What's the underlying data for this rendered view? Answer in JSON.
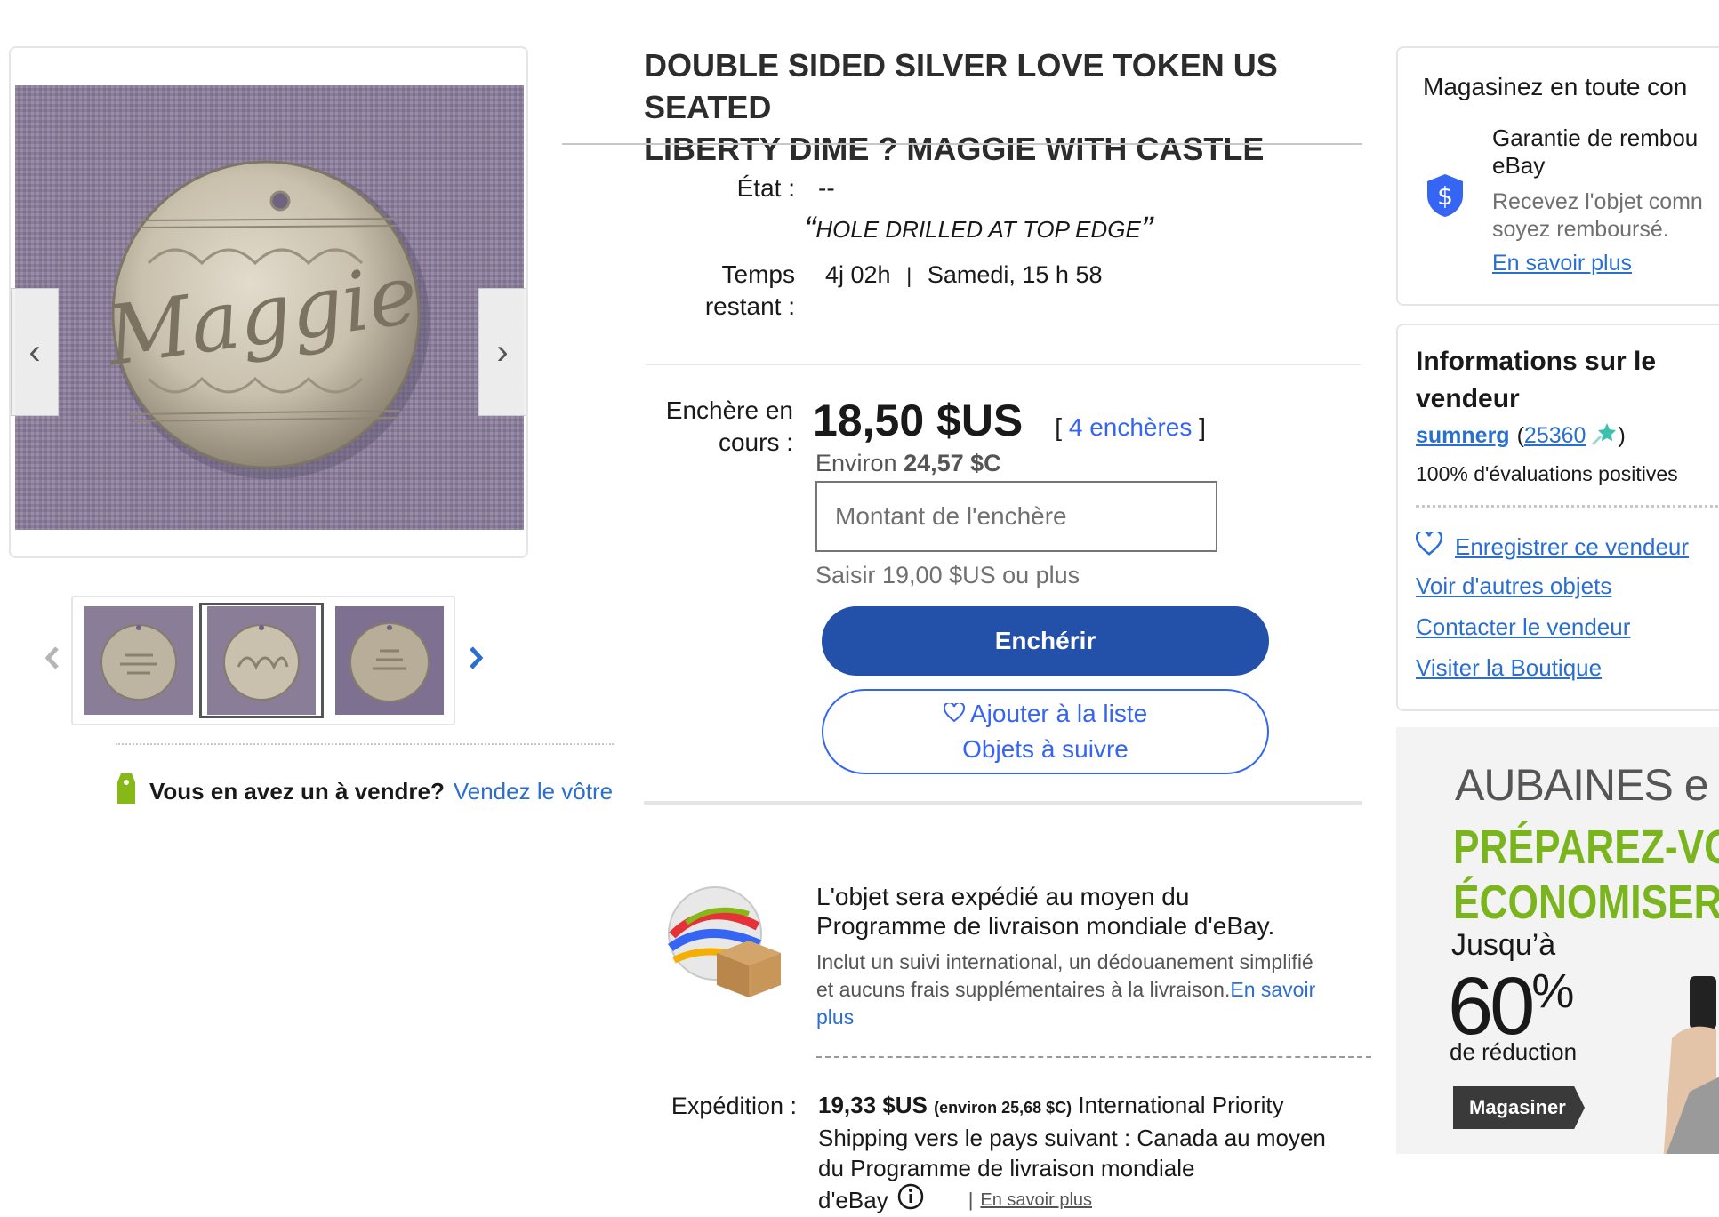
{
  "gallery": {
    "main_engraving": "Maggie",
    "prev_label": "‹",
    "next_label": "›"
  },
  "sell_prompt": {
    "question": "Vous en avez un à vendre?",
    "link": "Vendez le vôtre"
  },
  "listing": {
    "title_line1": "DOUBLE SIDED SILVER LOVE TOKEN US SEATED",
    "title_line2": "LIBERTY DIME ? MAGGIE WITH CASTLE",
    "condition_label": "État :",
    "condition_value": "--",
    "condition_note": "HOLE DRILLED AT TOP EDGE",
    "time_label_1": "Temps",
    "time_label_2": "restant :",
    "time_remaining": "4j 02h",
    "time_separator": "|",
    "end_time": "Samedi, 15 h 58"
  },
  "bid": {
    "label_1": "Enchère en",
    "label_2": "cours :",
    "price": "18,50 $US",
    "bids_open": "[",
    "bids_count": "4 enchères",
    "bids_close": "]",
    "approx_prefix": "Environ",
    "approx_value": "24,57 $C",
    "input_placeholder": "Montant de l'enchère",
    "hint": "Saisir 19,00 $US ou plus",
    "bid_button": "Enchérir",
    "watch_line1": "Ajouter à la liste",
    "watch_line2": "Objets à suivre"
  },
  "shipping_program": {
    "headline_1": "L'objet sera expédié au moyen du",
    "headline_2": "Programme de livraison mondiale d'eBay.",
    "desc_1": "Inclut un suivi international, un dédouanement simplifié",
    "desc_2": "et aucuns frais supplémentaires à la livraison.",
    "learn_more_1": "En savoir",
    "learn_more_2": "plus"
  },
  "shipping": {
    "label": "Expédition :",
    "price": "19,33 $US",
    "approx": "(environ 25,68 $C)",
    "line1_rest": "International Priority",
    "line2": "Shipping vers le pays suivant : Canada au moyen",
    "line3": "du Programme de livraison mondiale",
    "line4": "d'eBay",
    "sep": "|",
    "learn_more": "En savoir plus"
  },
  "guarantee": {
    "heading": "Magasinez en toute con",
    "title_1": "Garantie de rembou",
    "title_2": "eBay",
    "desc_1": "Recevez l'objet comn",
    "desc_2": "soyez remboursé.",
    "link": "En savoir plus"
  },
  "seller": {
    "heading_1": "Informations sur le",
    "heading_2": "vendeur",
    "name": "sumnerg",
    "open_paren": "(",
    "score": "25360",
    "close_paren": ")",
    "positive": "100% d'évaluations positives",
    "save": "Enregistrer ce vendeur",
    "other_items": "Voir d'autres objets",
    "contact": "Contacter le vendeur",
    "store": "Visiter la Boutique"
  },
  "promo": {
    "line1": "AUBAINES e",
    "line2": "PRÉPAREZ-VO",
    "line3": "ÉCONOMISER",
    "upto": "Jusqu’à",
    "percent": "60",
    "percent_sign": "%",
    "reduction": "de réduction",
    "button": "Magasiner"
  },
  "colors": {
    "accent": "#3665f3",
    "primary_button": "#2350a8",
    "promo_green": "#7ab51d"
  }
}
